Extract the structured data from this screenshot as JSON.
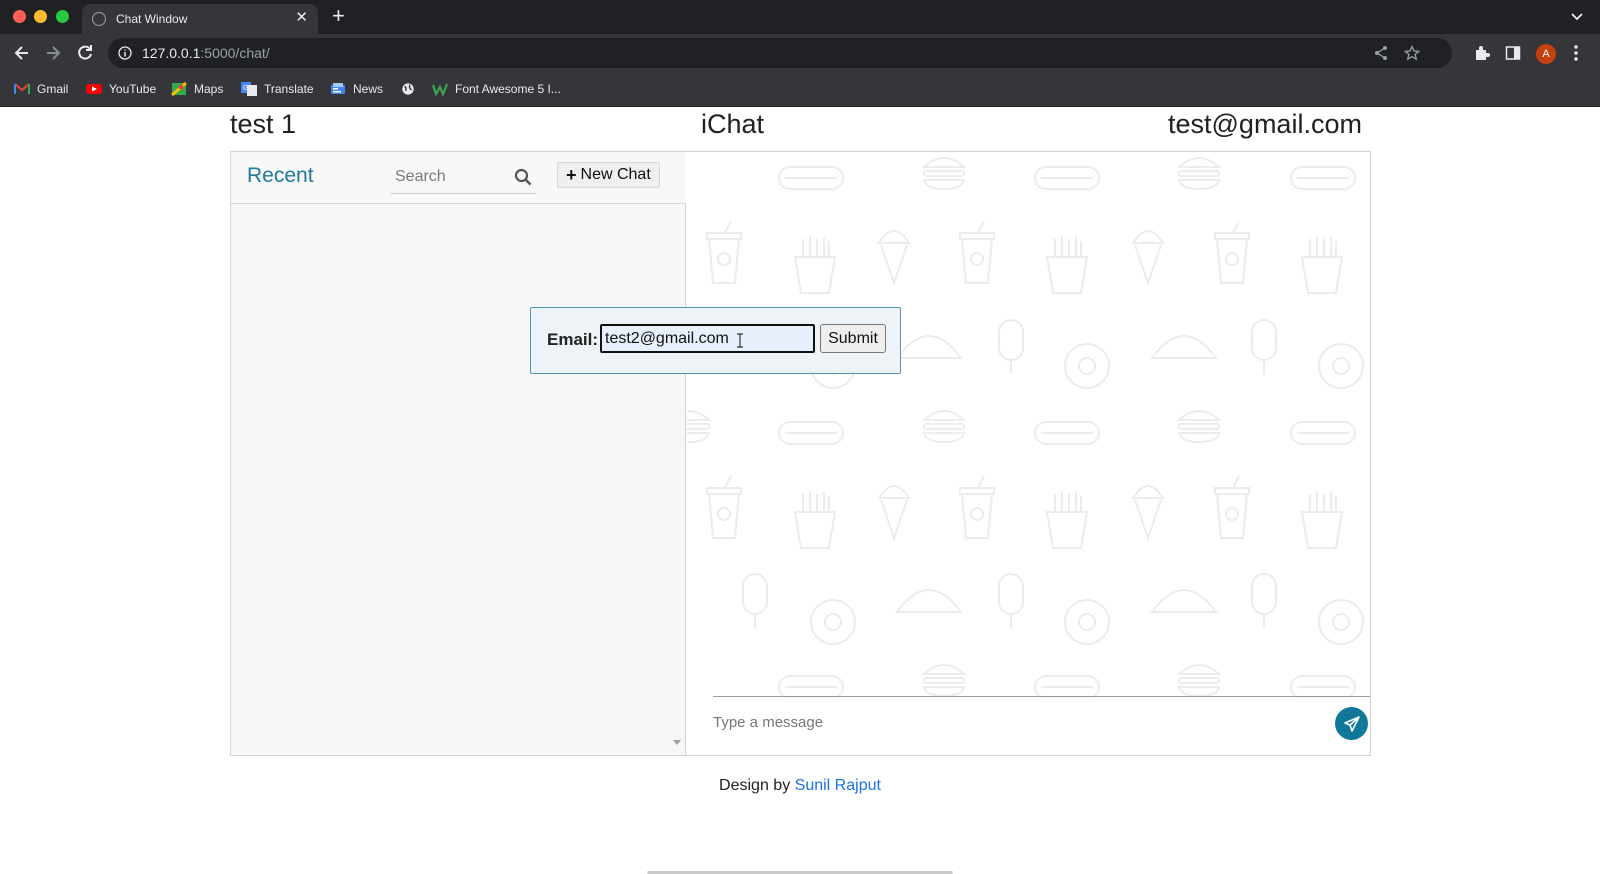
{
  "browser": {
    "tab_title": "Chat Window",
    "url_host": "127.0.0.1",
    "url_path": ":5000/chat/",
    "avatar_letter": "A",
    "bookmarks": [
      {
        "label": "Gmail",
        "icon": "gmail-icon"
      },
      {
        "label": "YouTube",
        "icon": "youtube-icon"
      },
      {
        "label": "Maps",
        "icon": "maps-icon"
      },
      {
        "label": "Translate",
        "icon": "translate-icon"
      },
      {
        "label": "News",
        "icon": "news-icon"
      },
      {
        "label": "",
        "icon": "globe-icon"
      },
      {
        "label": "Font Awesome 5 I...",
        "icon": "fontawesome-icon"
      }
    ]
  },
  "header": {
    "left": "test 1",
    "center": "iChat",
    "right": "test@gmail.com"
  },
  "sidebar": {
    "title": "Recent",
    "search_placeholder": "Search",
    "new_chat_label": "New Chat"
  },
  "popup": {
    "label": "Email:",
    "value": "test2@gmail.com",
    "submit_label": "Submit"
  },
  "conversation": {
    "message_placeholder": "Type a message"
  },
  "footer": {
    "prefix": "Design by",
    "author": "Sunil Rajput"
  },
  "colors": {
    "accent": "#1e7a96",
    "send_button": "#12789a",
    "link": "#1a73e8"
  }
}
